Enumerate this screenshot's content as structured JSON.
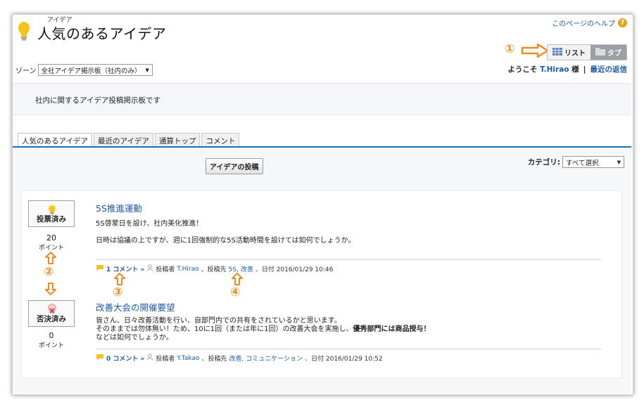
{
  "header": {
    "title_ruby": "アイデア",
    "title": "人気のあるアイデア",
    "help_link": "このページのヘルプ",
    "help_icon": "?"
  },
  "zone": {
    "label": "ゾーン",
    "selected": "全社アイデア掲示板（社内のみ）"
  },
  "view_toggle": {
    "list_label": "リスト",
    "tab_label": "タブ"
  },
  "welcome": {
    "prefix": "ようこそ",
    "user": "T.Hirao",
    "suffix": "様",
    "separator": "|",
    "recent_replies": "最近の返信"
  },
  "description": "社内に関するアイデア投稿掲示板です",
  "tabs": [
    {
      "label": "人気のあるアイデア",
      "active": true
    },
    {
      "label": "最近のアイデア",
      "active": false
    },
    {
      "label": "通算トップ",
      "active": false
    },
    {
      "label": "コメント",
      "active": false
    }
  ],
  "post_button": "アイデアの投稿",
  "category": {
    "label": "カテゴリ:",
    "selected": "すべて選択"
  },
  "annotations": {
    "n1": "①",
    "n2": "②",
    "n3": "③",
    "n4": "④"
  },
  "ideas": [
    {
      "vote_status": "投票済み",
      "points": "20",
      "points_label": "ポイント",
      "title": "5S推進運動",
      "body_lines": [
        "5S啓蒙日を設け、社内美化推進！",
        "日時は協議の上ですが、週に1回強制的な5S活動時間を設けては如何でしょうか。"
      ],
      "comments": "1 コメント »",
      "author_label": "投稿者",
      "author": "T.Hirao",
      "target_label": "、投稿先",
      "categories": "5S, 改善",
      "date": "、日付 2016/01/29 10:46"
    },
    {
      "vote_status": "否決済み",
      "points": "0",
      "points_label": "ポイント",
      "title": "改善大会の開催要望",
      "body_line1": "皆さん、日々改善活動を行い、自部門内での共有をされているかと思います。",
      "body_line2": "そのままでは勿体無い！ため、10に1回（または年に1回）の改善大会を実施し、",
      "body_line2_bold": "優秀部門には商品授与！",
      "body_line3": "などは如何でしょうか。",
      "comments": "0 コメント »",
      "author_label": "投稿者",
      "author": "Y.Takao",
      "target_label": "、投稿先",
      "categories": "改善, コミュニケーション",
      "date": "、日付 2016/01/29 10:52"
    }
  ],
  "colors": {
    "link": "#1a5ba6",
    "annotation": "#f08a1f",
    "tab_line": "#1b6fb5"
  }
}
